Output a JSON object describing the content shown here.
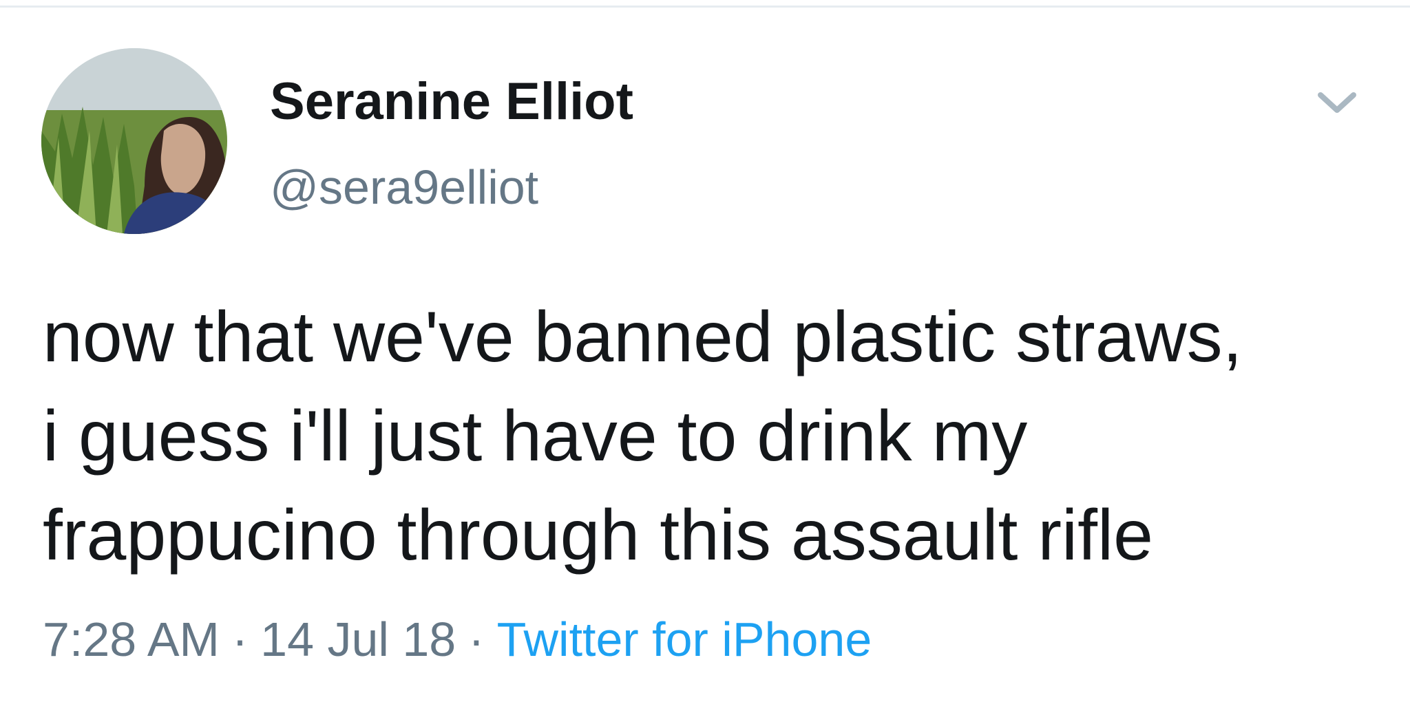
{
  "tweet": {
    "author": {
      "display_name": "Seranine Elliot",
      "handle": "@sera9elliot"
    },
    "text_lines": [
      "now that we've banned plastic straws,",
      "i guess i'll just have to drink my",
      "frappucino through this assault rifle"
    ],
    "time": "7:28 AM",
    "date": "14 Jul 18",
    "separator": "·",
    "source": "Twitter for iPhone"
  },
  "icons": {
    "menu": "chevron-down-icon"
  },
  "colors": {
    "primary_text": "#14171a",
    "secondary_text": "#657786",
    "link": "#1da1f2",
    "divider": "#e6ecf0"
  }
}
